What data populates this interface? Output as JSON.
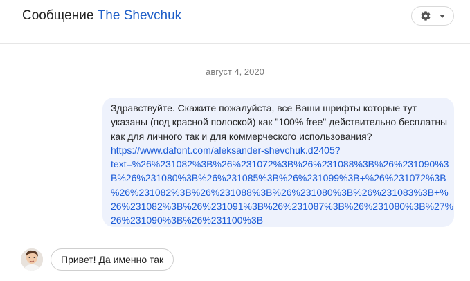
{
  "header": {
    "title_prefix": "Сообщение",
    "title_name": "The Shevchuk",
    "settings_icon": "gear-icon",
    "dropdown_icon": "caret-down-icon"
  },
  "thread": {
    "date": "август 4, 2020",
    "message": {
      "text_lines": [
        "Здравствуйте. Скажите пожалуйста, все Ваши шрифты которые тут",
        "указаны (под красной полоской) как \"100% free\" действительно бесплатны",
        "как для личного так и для коммерческого использования?"
      ],
      "link_lines": [
        "https://www.dafont.com/aleksander-shevchuk.d2405?",
        "text=%26%231082%3B%26%231072%3B%26%231088%3B%26%231090%3",
        "B%26%231080%3B%26%231085%3B%26%231099%3B+%26%231072%3B",
        "%26%231082%3B%26%231088%3B%26%231080%3B%26%231083%3B+%",
        "26%231082%3B%26%231091%3B%26%231087%3B%26%231080%3B%27%",
        "26%231090%3B%26%231100%3B"
      ]
    },
    "reply": {
      "text": "Привет! Да именно так"
    }
  },
  "colors": {
    "accent": "#1f5fc8",
    "link": "#1a5ad7",
    "bubble": "#eef2fc"
  }
}
